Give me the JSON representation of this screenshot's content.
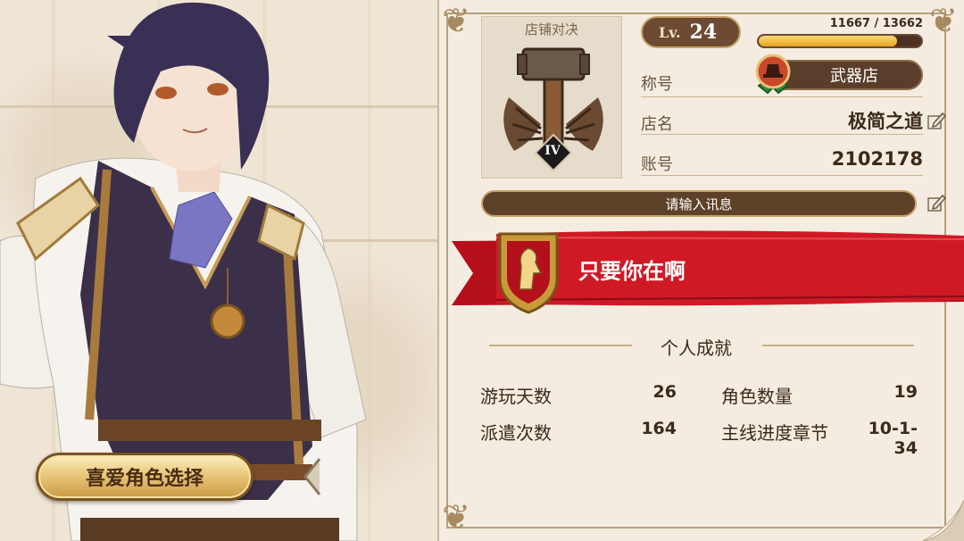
{
  "favorite_button": {
    "label": "喜爱角色选择"
  },
  "badge": {
    "title": "店铺对决",
    "rank": "IV"
  },
  "level": {
    "label": "Lv.",
    "value": "24",
    "exp_current": 11667,
    "exp_max": 13662,
    "exp_text": "11667 / 13662",
    "exp_fraction": 0.854
  },
  "profile": {
    "title_label": "称号",
    "title_value": "武器店",
    "shop_label": "店名",
    "shop_value": "极简之道",
    "account_label": "账号",
    "account_value": "2102178"
  },
  "message": {
    "placeholder": "请输入讯息"
  },
  "banner": {
    "text": "只要你在啊"
  },
  "achievements": {
    "title": "个人成就",
    "items": [
      {
        "label": "游玩天数",
        "value": "26"
      },
      {
        "label": "角色数量",
        "value": "19"
      },
      {
        "label": "派遣次数",
        "value": "164"
      },
      {
        "label": "主线进度章节",
        "value": "10-1-34"
      }
    ]
  },
  "colors": {
    "banner_red": "#c0121f",
    "gold": "#e5a51f",
    "dark_brown": "#5a3d2a"
  }
}
